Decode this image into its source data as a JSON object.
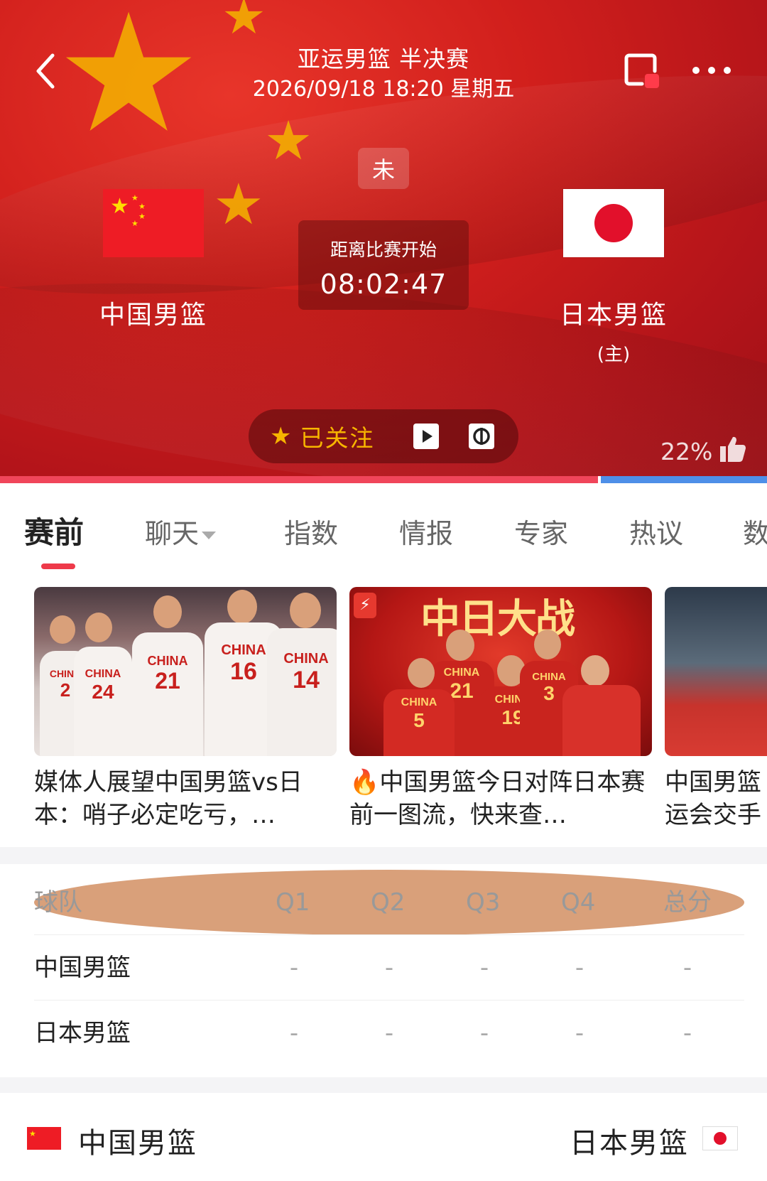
{
  "header": {
    "title": "亚运男篮 半决赛",
    "datetime": "2026/09/18 18:20 星期五",
    "status": "未",
    "countdown_label": "距离比赛开始",
    "countdown_value": "08:02:47",
    "home": {
      "name": "中国男篮",
      "flag": "flag-china"
    },
    "away": {
      "name": "日本男篮",
      "tag": "(主)",
      "flag": "flag-japan"
    },
    "follow_label": "已关注",
    "like_percent": "22%",
    "support_ratio_home": 0.78,
    "colors": {
      "home_bar": "#f0455a",
      "away_bar": "#4e8fe8",
      "accent": "#ee3a4a",
      "follow": "#f7b500"
    }
  },
  "tabs": [
    {
      "label": "赛前",
      "active": true
    },
    {
      "label": "聊天"
    },
    {
      "label": "指数"
    },
    {
      "label": "情报"
    },
    {
      "label": "专家"
    },
    {
      "label": "热议"
    },
    {
      "label": "数"
    }
  ],
  "news": [
    {
      "title": "媒体人展望中国男篮vs日本：哨子必定吃亏，…"
    },
    {
      "title": "🔥中国男篮今日对阵日本赛前一图流，快来查…",
      "image_text": "中日大战"
    },
    {
      "title": "中国男篮运会交手"
    }
  ],
  "score_table": {
    "headers": [
      "球队",
      "Q1",
      "Q2",
      "Q3",
      "Q4",
      "总分"
    ],
    "rows": [
      {
        "team": "中国男篮",
        "values": [
          "-",
          "-",
          "-",
          "-",
          "-"
        ]
      },
      {
        "team": "日本男篮",
        "values": [
          "-",
          "-",
          "-",
          "-",
          "-"
        ]
      }
    ]
  },
  "bottom": {
    "left_team": "中国男篮",
    "right_team": "日本男篮"
  },
  "jerseys": {
    "brand": "CHINA",
    "card1": [
      "2",
      "24",
      "21",
      "16",
      "14"
    ],
    "card2": [
      "5",
      "21",
      "19",
      "3"
    ]
  }
}
